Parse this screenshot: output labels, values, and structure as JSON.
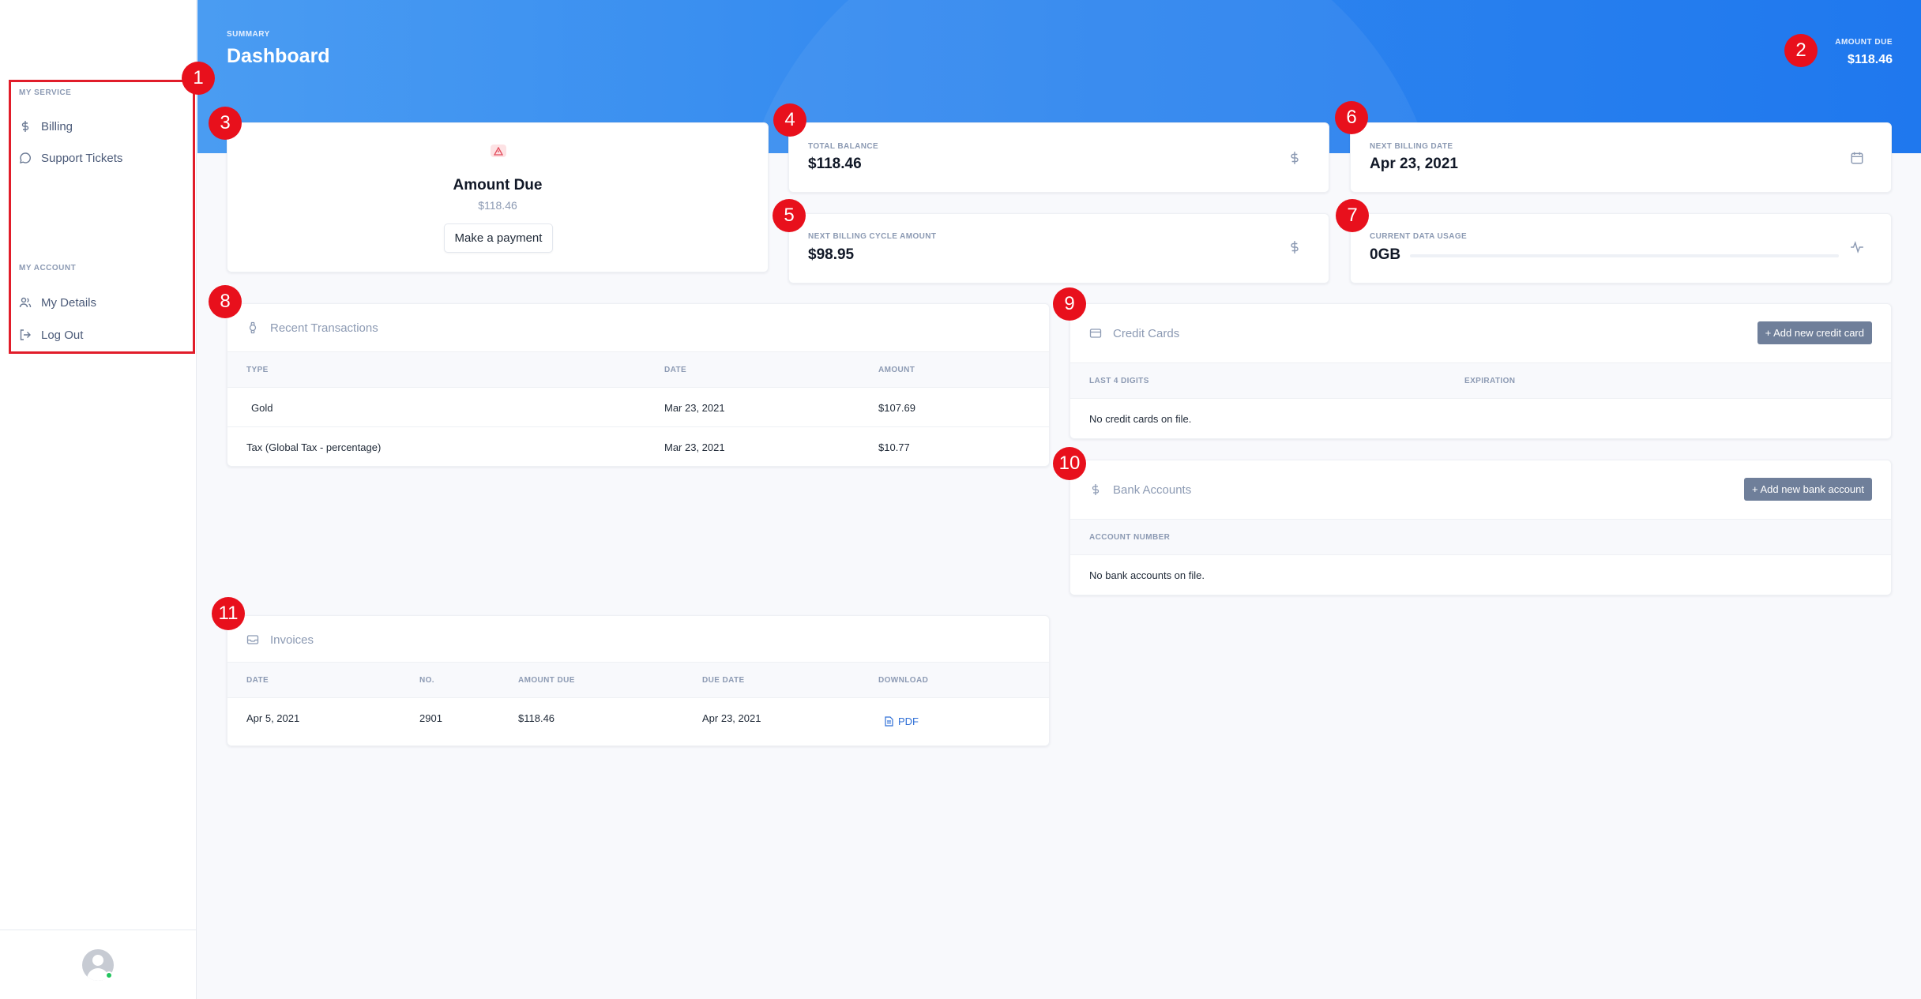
{
  "sidebar": {
    "service_heading": "MY SERVICE",
    "service_items": [
      {
        "label": "Billing",
        "icon": "dollar-icon"
      },
      {
        "label": "Support Tickets",
        "icon": "chat-bubble-icon"
      }
    ],
    "account_heading": "MY ACCOUNT",
    "account_items": [
      {
        "label": "My Details",
        "icon": "users-icon"
      },
      {
        "label": "Log Out",
        "icon": "logout-icon"
      }
    ]
  },
  "header": {
    "subtitle": "SUMMARY",
    "title": "Dashboard",
    "amount_due_label": "AMOUNT DUE",
    "amount_due_value": "$118.46"
  },
  "amount_card": {
    "title": "Amount Due",
    "value": "$118.46",
    "button": "Make a payment"
  },
  "stats": {
    "total_balance": {
      "label": "TOTAL BALANCE",
      "value": "$118.46"
    },
    "next_billing_date": {
      "label": "NEXT BILLING DATE",
      "value": "Apr 23, 2021"
    },
    "next_cycle_amount": {
      "label": "NEXT BILLING CYCLE AMOUNT",
      "value": "$98.95"
    },
    "data_usage": {
      "label": "CURRENT DATA USAGE",
      "value": "0GB",
      "progress": 0
    }
  },
  "transactions": {
    "title": "Recent Transactions",
    "headers": [
      "TYPE",
      "DATE",
      "AMOUNT"
    ],
    "rows": [
      [
        "Gold",
        "Mar 23, 2021",
        "$107.69"
      ],
      [
        "Tax (Global Tax - percentage)",
        "Mar 23, 2021",
        "$10.77"
      ]
    ]
  },
  "credit_cards": {
    "title": "Credit Cards",
    "button": "+ Add new credit card",
    "headers": [
      "LAST 4 DIGITS",
      "EXPIRATION"
    ],
    "empty": "No credit cards on file."
  },
  "bank_accounts": {
    "title": "Bank Accounts",
    "button": "+ Add new bank account",
    "headers": [
      "ACCOUNT NUMBER"
    ],
    "empty": "No bank accounts on file."
  },
  "invoices": {
    "title": "Invoices",
    "headers": [
      "DATE",
      "NO.",
      "AMOUNT DUE",
      "DUE DATE",
      "DOWNLOAD"
    ],
    "rows": [
      [
        "Apr 5, 2021",
        "2901",
        "$118.46",
        "Apr 23, 2021",
        "PDF"
      ]
    ]
  },
  "markers": [
    "1",
    "2",
    "3",
    "4",
    "5",
    "6",
    "7",
    "8",
    "9",
    "10",
    "11"
  ],
  "colors": {
    "accent": "#2f86ef",
    "marker": "#e8101c",
    "muted": "#8c9ab3",
    "button": "#6f7f9a",
    "online": "#22c55e"
  }
}
